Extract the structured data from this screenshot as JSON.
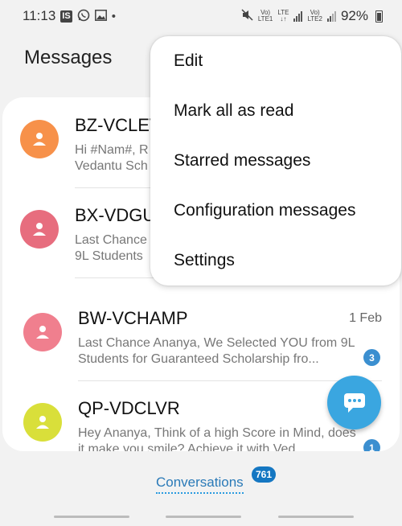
{
  "status_bar": {
    "time": "11:13",
    "notif_badge": "IS",
    "sim1_top": "Vo)",
    "sim1_bottom": "LTE1",
    "sim2_top": "LTE",
    "sim2_bottom": "Vo)",
    "sim2_label": "LTE2",
    "battery": "92%"
  },
  "header": {
    "title": "Messages"
  },
  "menu": {
    "items": [
      "Edit",
      "Mark all as read",
      "Starred messages",
      "Configuration messages",
      "Settings"
    ]
  },
  "conversations": [
    {
      "name": "BZ-VCLEV",
      "preview": "Hi #Nam#, R\nVedantu Sch",
      "date": "",
      "unread": "",
      "avatar_color": "#f7914a"
    },
    {
      "name": "BX-VDGU",
      "preview": "Last Chance\n9L Students",
      "date": "",
      "unread": "",
      "avatar_color": "#e76d7e"
    },
    {
      "name": "BW-VCHAMP",
      "preview": "Last Chance Ananya, We Selected YOU from 9L Students for Guaranteed Scholarship fro...",
      "date": "1 Feb",
      "unread": "3",
      "avatar_color": "#f07f8e"
    },
    {
      "name": "QP-VDCLVR",
      "preview": "Hey Ananya, Think of a high Score in Mind, does it make you smile? Achieve it with Ved...",
      "date": "",
      "unread": "1",
      "avatar_color": "#d9df3a"
    }
  ],
  "bottom_tab": {
    "label": "Conversations",
    "count": "761"
  },
  "colors": {
    "accent": "#3aa6e0",
    "badge": "#3b8fd0",
    "tab_text": "#2a7ab8"
  },
  "icons": {
    "fab": "chat-bubble-icon",
    "avatar": "person-icon",
    "mute": "mute-icon",
    "whatsapp": "whatsapp-icon",
    "gallery": "image-icon"
  }
}
